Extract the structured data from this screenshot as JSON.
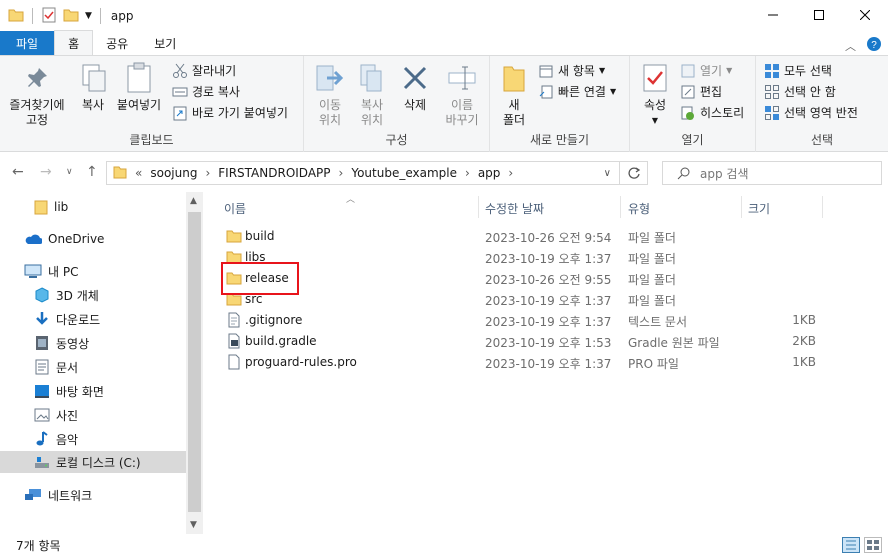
{
  "window": {
    "title": "app"
  },
  "tabs": {
    "file": "파일",
    "home": "홈",
    "share": "공유",
    "view": "보기"
  },
  "ribbon": {
    "clipboard": {
      "pin": "즐겨찾기에\n고정",
      "copy": "복사",
      "paste": "붙여넣기",
      "cut": "잘라내기",
      "copy_path": "경로 복사",
      "paste_shortcut": "바로 가기 붙여넣기",
      "label": "클립보드"
    },
    "organize": {
      "move_to": "이동\n위치",
      "copy_to": "복사\n위치",
      "delete": "삭제",
      "rename": "이름\n바꾸기",
      "label": "구성"
    },
    "new": {
      "new_folder": "새\n폴더",
      "new_item": "새 항목",
      "easy_access": "빠른 연결",
      "label": "새로 만들기"
    },
    "open": {
      "properties": "속성",
      "open": "열기",
      "edit": "편집",
      "history": "히스토리",
      "label": "열기"
    },
    "select": {
      "select_all": "모두 선택",
      "select_none": "선택 안 함",
      "invert": "선택 영역 반전",
      "label": "선택"
    }
  },
  "address": {
    "prefix": "«",
    "crumbs": [
      "soojung",
      "FIRSTANDROIDAPP",
      "Youtube_example",
      "app"
    ],
    "search_placeholder": "app 검색"
  },
  "navpane": {
    "items": [
      {
        "label": "lib",
        "icon": "folder-icon"
      },
      {
        "label": "OneDrive",
        "icon": "onedrive-icon"
      },
      {
        "label": "내 PC",
        "icon": "pc-icon"
      },
      {
        "label": "3D 개체",
        "icon": "3d-objects-icon"
      },
      {
        "label": "다운로드",
        "icon": "download-icon"
      },
      {
        "label": "동영상",
        "icon": "video-icon"
      },
      {
        "label": "문서",
        "icon": "document-icon"
      },
      {
        "label": "바탕 화면",
        "icon": "desktop-icon"
      },
      {
        "label": "사진",
        "icon": "pictures-icon"
      },
      {
        "label": "음악",
        "icon": "music-icon"
      },
      {
        "label": "로컬 디스크 (C:)",
        "icon": "drive-icon"
      },
      {
        "label": "네트워크",
        "icon": "network-icon"
      }
    ]
  },
  "columns": {
    "name": "이름",
    "date": "수정한 날짜",
    "type": "유형",
    "size": "크기"
  },
  "files": [
    {
      "name": "build",
      "date": "2023-10-26 오전 9:54",
      "type": "파일 폴더",
      "size": "",
      "icon": "folder-icon"
    },
    {
      "name": "libs",
      "date": "2023-10-19 오후 1:37",
      "type": "파일 폴더",
      "size": "",
      "icon": "folder-icon"
    },
    {
      "name": "release",
      "date": "2023-10-26 오전 9:55",
      "type": "파일 폴더",
      "size": "",
      "icon": "folder-icon"
    },
    {
      "name": "src",
      "date": "2023-10-19 오후 1:37",
      "type": "파일 폴더",
      "size": "",
      "icon": "folder-icon"
    },
    {
      "name": ".gitignore",
      "date": "2023-10-19 오후 1:37",
      "type": "텍스트 문서",
      "size": "1KB",
      "icon": "text-file-icon"
    },
    {
      "name": "build.gradle",
      "date": "2023-10-19 오후 1:53",
      "type": "Gradle 원본 파일",
      "size": "2KB",
      "icon": "gradle-file-icon"
    },
    {
      "name": "proguard-rules.pro",
      "date": "2023-10-19 오후 1:37",
      "type": "PRO 파일",
      "size": "1KB",
      "icon": "file-icon"
    }
  ],
  "status": {
    "count": "7개 항목"
  },
  "colors": {
    "file_tab": "#1979ca",
    "folder": "#f8d775",
    "highlight": "#e8141b"
  }
}
